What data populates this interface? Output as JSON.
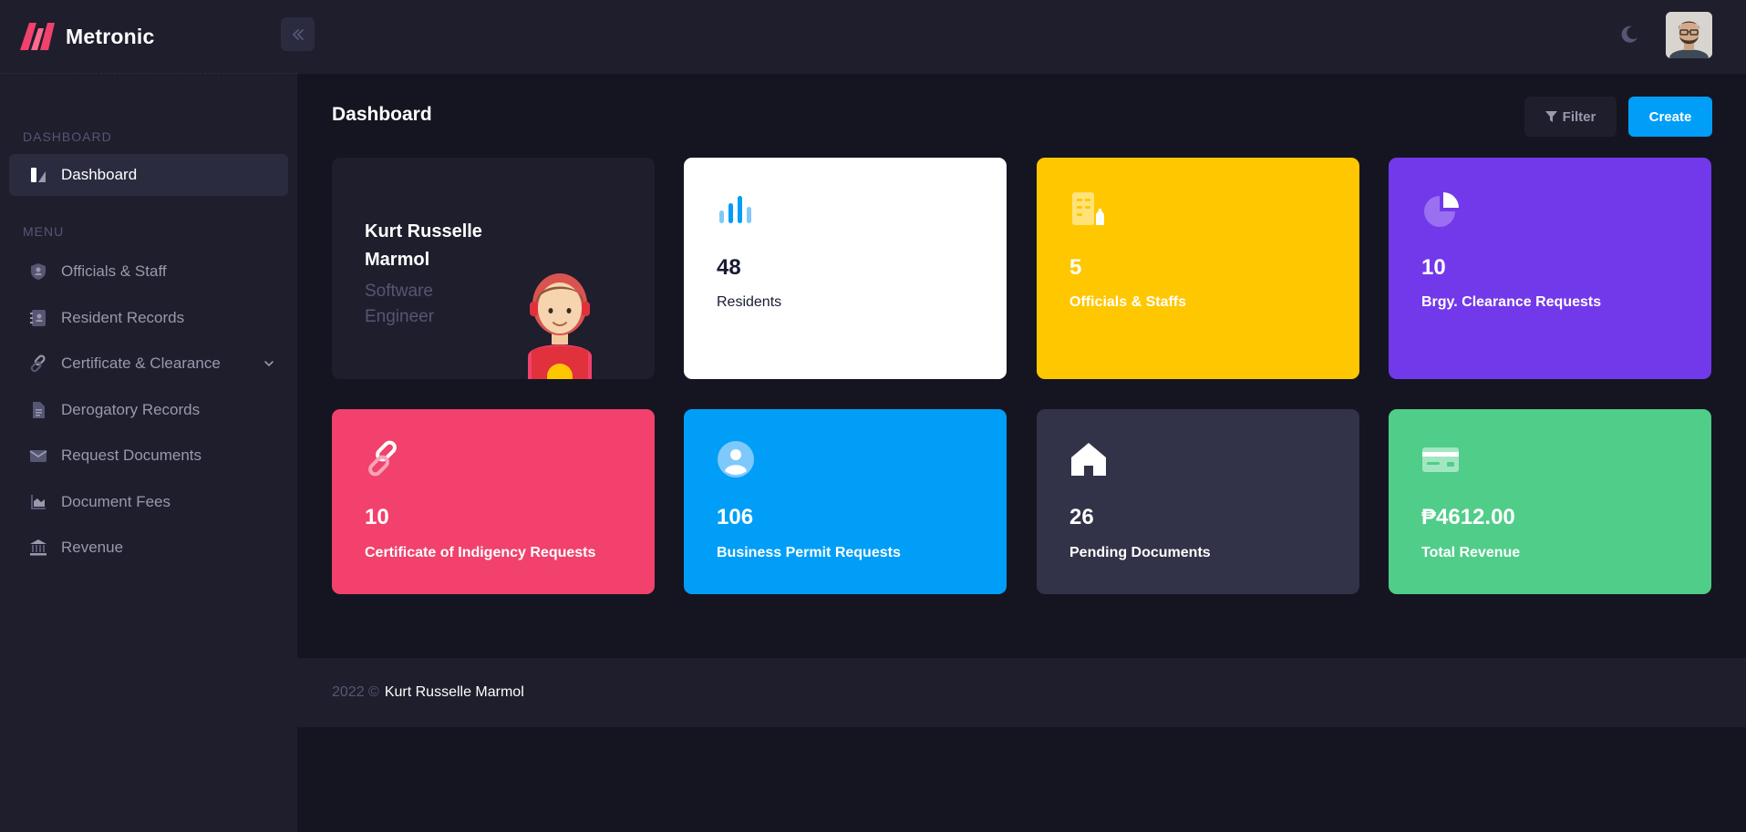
{
  "brand": {
    "name": "Metronic"
  },
  "sidebar": {
    "section_dashboard": "DASHBOARD",
    "dashboard_item": "Dashboard",
    "section_menu": "MENU",
    "items": [
      {
        "label": "Officials & Staff",
        "icon": "shield-user-icon"
      },
      {
        "label": "Resident Records",
        "icon": "address-book-icon"
      },
      {
        "label": "Certificate & Clearance",
        "icon": "link-icon"
      },
      {
        "label": "Derogatory Records",
        "icon": "document-icon"
      },
      {
        "label": "Request Documents",
        "icon": "envelope-icon"
      },
      {
        "label": "Document Fees",
        "icon": "chart-icon"
      },
      {
        "label": "Revenue",
        "icon": "bank-icon"
      }
    ]
  },
  "toolbar": {
    "title": "Dashboard",
    "filter_label": "Filter",
    "create_label": "Create"
  },
  "profile": {
    "name": "Kurt Russelle Marmol",
    "role": "Software Engineer"
  },
  "stats": [
    {
      "value": "48",
      "label": "Residents",
      "color": "#ffffff"
    },
    {
      "value": "5",
      "label": "Officials & Staffs",
      "color": "#ffc700"
    },
    {
      "value": "10",
      "label": "Brgy. Clearance Requests",
      "color": "#7239ea"
    },
    {
      "value": "10",
      "label": "Certificate of Indigency Requests",
      "color": "#f1416c"
    },
    {
      "value": "106",
      "label": "Business Permit Requests",
      "color": "#009ef7"
    },
    {
      "value": "26",
      "label": "Pending Documents",
      "color": "#323248"
    },
    {
      "value": "₱4612.00",
      "label": "Total Revenue",
      "color": "#50cd89"
    }
  ],
  "footer": {
    "year": "2022 ©",
    "author": "Kurt Russelle Marmol"
  }
}
